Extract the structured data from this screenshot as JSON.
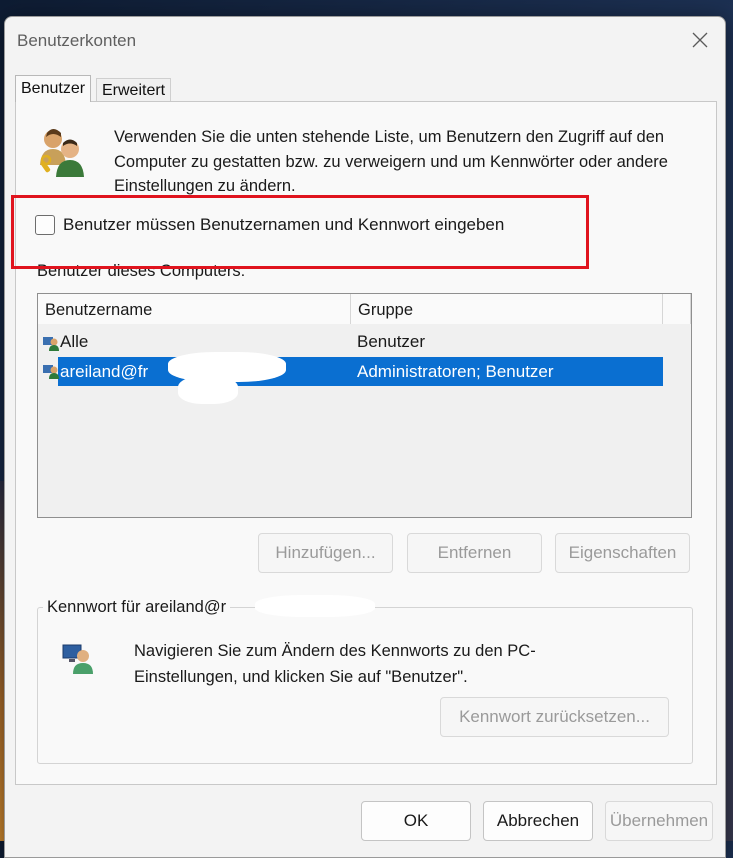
{
  "window": {
    "title": "Benutzerkonten"
  },
  "tabs": [
    {
      "label": "Benutzer"
    },
    {
      "label": "Erweitert"
    }
  ],
  "intro": {
    "text": "Verwenden Sie die unten stehende Liste, um Benutzern den Zugriff auf den Computer zu gestatten bzw. zu verweigern und um Kennwörter oder andere Einstellungen zu ändern."
  },
  "checkbox": {
    "label": "Benutzer müssen Benutzernamen und Kennwort eingeben",
    "checked": false
  },
  "users_section": {
    "label": "Benutzer dieses Computers:"
  },
  "table": {
    "columns": [
      "Benutzername",
      "Gruppe"
    ],
    "rows": [
      {
        "name": "Alle",
        "group": "Benutzer",
        "selected": false
      },
      {
        "name": "areiland@fr",
        "group": "Administratoren; Benutzer",
        "selected": true
      }
    ]
  },
  "buttons": {
    "add": "Hinzufügen...",
    "remove": "Entfernen",
    "properties": "Eigenschaften"
  },
  "password_group": {
    "title": "Kennwort für areiland@r",
    "text": "Navigieren Sie zum Ändern des Kennworts zu den PC-Einstellungen, und klicken Sie auf \"Benutzer\".",
    "reset_button": "Kennwort zurücksetzen..."
  },
  "footer": {
    "ok": "OK",
    "cancel": "Abbrechen",
    "apply": "Übernehmen"
  },
  "colors": {
    "selection": "#0a6fd1",
    "highlight": "#e0141e",
    "dialog_bg": "#f3f3f3"
  },
  "icons": {
    "close": "close-icon",
    "users": "users-icon",
    "user": "user-icon",
    "computer_user": "computer-user-icon"
  }
}
